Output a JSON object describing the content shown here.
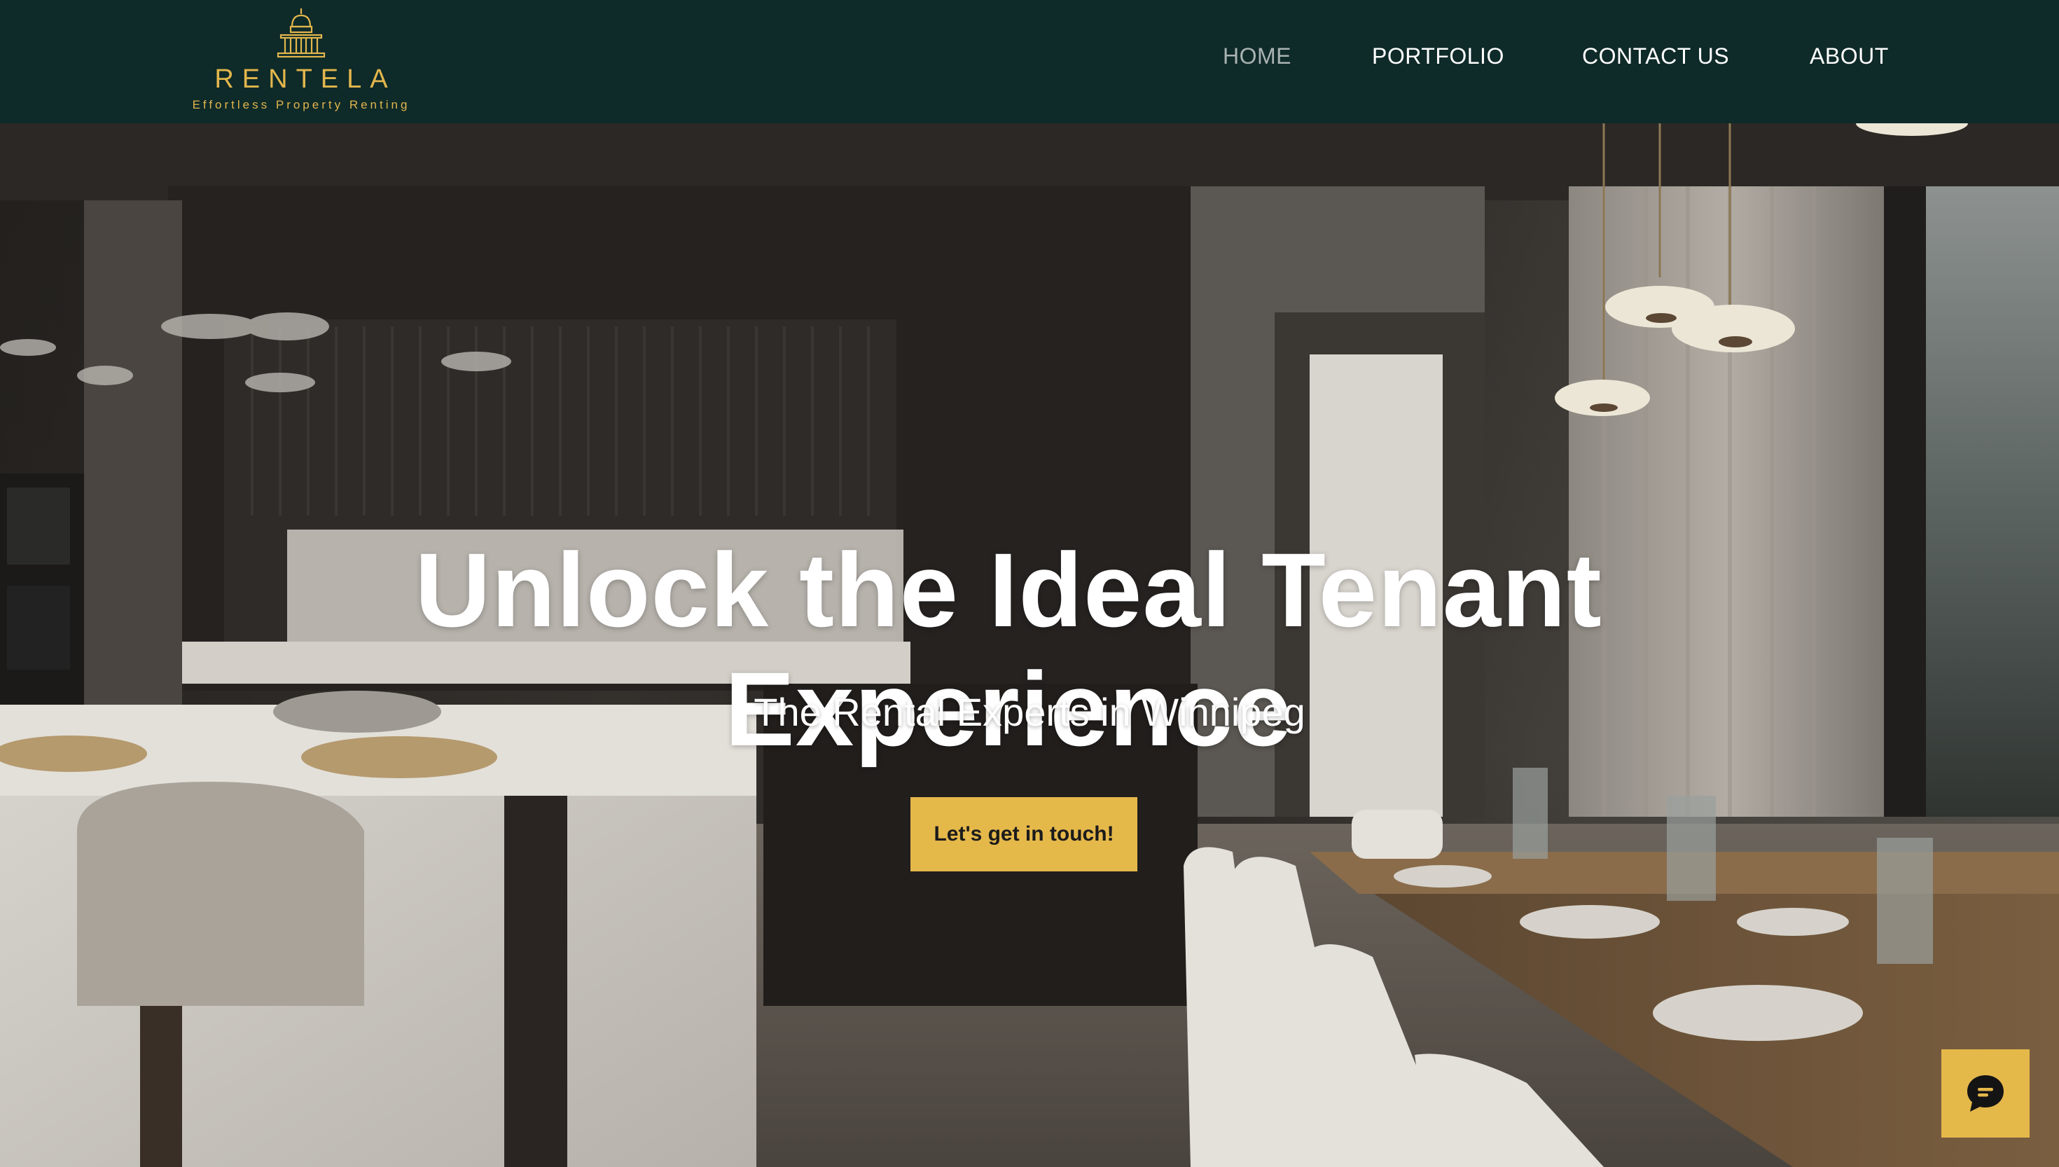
{
  "brand": {
    "name": "RENTELA",
    "tagline": "Effortless Property Renting",
    "logo_icon": "capitol-building-icon",
    "accent_color": "#e5b84a",
    "header_bg": "#0e2a29"
  },
  "nav": {
    "items": [
      {
        "label": "HOME",
        "active": true
      },
      {
        "label": "PORTFOLIO",
        "active": false
      },
      {
        "label": "CONTACT US",
        "active": false
      },
      {
        "label": "ABOUT",
        "active": false
      }
    ]
  },
  "hero": {
    "title_line1": "Unlock the Ideal Tenant",
    "title_line2": "Experience",
    "subtitle": "The Rental Experts in Winnipeg",
    "cta_label": "Let's get in touch!",
    "background": "kitchen-dining-interior"
  },
  "chat": {
    "icon": "chat-bubble-icon"
  }
}
